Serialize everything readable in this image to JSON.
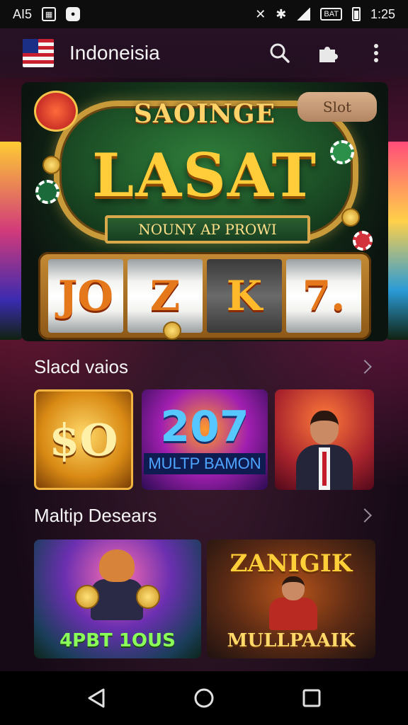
{
  "status_bar": {
    "carrier": "AI5",
    "time": "1:25",
    "battery_tag": "BAT"
  },
  "app_bar": {
    "title": "Indoneisia"
  },
  "hero": {
    "badge_text": "",
    "slot_button": "Slot",
    "subtitle": "SAOINGE",
    "title": "LASAT",
    "plaque": "NOUNY AP PROWI",
    "reels": [
      "JO",
      "Z",
      "K",
      "7."
    ]
  },
  "section_1": {
    "title": "Slacd vaios",
    "tiles": [
      {
        "text": "$O"
      },
      {
        "big": "207",
        "small": "MULTP BAMON"
      },
      {
        "text": ""
      }
    ]
  },
  "section_2": {
    "title": "Maltip Desears",
    "tiles": [
      {
        "caption": "4PBT 1OUS"
      },
      {
        "top": "ZANIGIK",
        "bottom": "MULLPAAIK"
      }
    ]
  },
  "colors": {
    "gold": "#ffcc3a",
    "felt": "#1c4f26",
    "background": "#1b0f1c"
  },
  "icons": {
    "search": "search-icon",
    "puzzle": "puzzle-icon",
    "more": "more-vert-icon",
    "back": "back-icon",
    "home": "home-icon",
    "recents": "recents-icon"
  }
}
